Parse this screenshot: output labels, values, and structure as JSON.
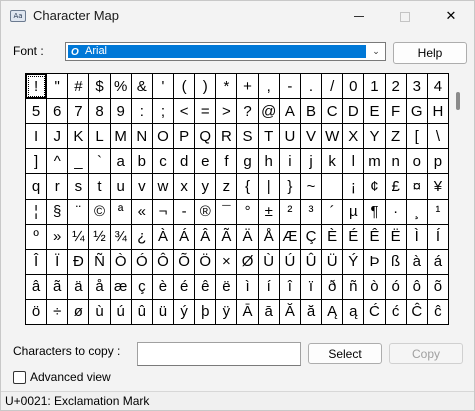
{
  "window": {
    "title": "Character Map",
    "icon": "character-map-icon",
    "close_glyph": "✕"
  },
  "font": {
    "label": "Font :",
    "selected": "Arial",
    "arrow": "⌄"
  },
  "help_label": "Help",
  "characters": [
    "!",
    "\"",
    "#",
    "$",
    "%",
    "&",
    "'",
    "(",
    ")",
    "*",
    "+",
    ",",
    "-",
    ".",
    "/",
    "0",
    "1",
    "2",
    "3",
    "4",
    "5",
    "6",
    "7",
    "8",
    "9",
    ":",
    ";",
    "<",
    "=",
    ">",
    "?",
    "@",
    "A",
    "B",
    "C",
    "D",
    "E",
    "F",
    "G",
    "H",
    "I",
    "J",
    "K",
    "L",
    "M",
    "N",
    "O",
    "P",
    "Q",
    "R",
    "S",
    "T",
    "U",
    "V",
    "W",
    "X",
    "Y",
    "Z",
    "[",
    "\\",
    "]",
    "^",
    "_",
    "`",
    "a",
    "b",
    "c",
    "d",
    "e",
    "f",
    "g",
    "h",
    "i",
    "j",
    "k",
    "l",
    "m",
    "n",
    "o",
    "p",
    "q",
    "r",
    "s",
    "t",
    "u",
    "v",
    "w",
    "x",
    "y",
    "z",
    "{",
    "|",
    "}",
    "~",
    " ",
    "¡",
    "¢",
    "£",
    "¤",
    "¥",
    "¦",
    "§",
    "¨",
    "©",
    "ª",
    "«",
    "¬",
    "-",
    "®",
    "¯",
    "°",
    "±",
    "²",
    "³",
    "´",
    "µ",
    "¶",
    "·",
    "¸",
    "¹",
    "º",
    "»",
    "¼",
    "½",
    "¾",
    "¿",
    "À",
    "Á",
    "Â",
    "Ã",
    "Ä",
    "Å",
    "Æ",
    "Ç",
    "È",
    "É",
    "Ê",
    "Ë",
    "Ì",
    "Í",
    "Î",
    "Ï",
    "Ð",
    "Ñ",
    "Ò",
    "Ó",
    "Ô",
    "Õ",
    "Ö",
    "×",
    "Ø",
    "Ù",
    "Ú",
    "Û",
    "Ü",
    "Ý",
    "Þ",
    "ß",
    "à",
    "á",
    "â",
    "ã",
    "ä",
    "å",
    "æ",
    "ç",
    "è",
    "é",
    "ê",
    "ë",
    "ì",
    "í",
    "î",
    "ï",
    "ð",
    "ñ",
    "ò",
    "ó",
    "ô",
    "õ",
    "ö",
    "÷",
    "ø",
    "ù",
    "ú",
    "û",
    "ü",
    "ý",
    "þ",
    "ÿ",
    "Ā",
    "ā",
    "Ă",
    "ă",
    "Ą",
    "ą",
    "Ć",
    "ć",
    "Ĉ",
    "ĉ"
  ],
  "selected_index": 0,
  "copy": {
    "label": "Characters to copy :",
    "value": "",
    "select_label": "Select",
    "copy_label": "Copy"
  },
  "advanced_view": {
    "label": "Advanced view",
    "checked": false
  },
  "status": "U+0021: Exclamation Mark"
}
